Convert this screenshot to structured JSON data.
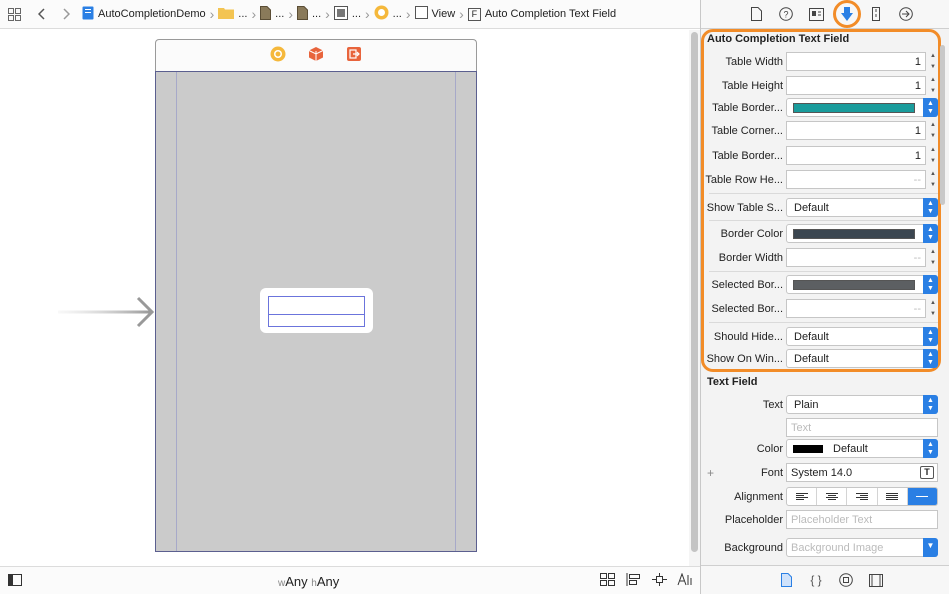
{
  "breadcrumb": {
    "items": [
      {
        "label": "AutoCompletionDemo",
        "icon": "project-icon"
      },
      {
        "label": "...",
        "icon": "folder-icon"
      },
      {
        "label": "...",
        "icon": "file-icon"
      },
      {
        "label": "...",
        "icon": "file-icon"
      },
      {
        "label": "...",
        "icon": "scene-icon"
      },
      {
        "label": "...",
        "icon": "viewcontroller-icon"
      },
      {
        "label": "View",
        "icon": "view-icon"
      },
      {
        "label": "Auto Completion Text Field",
        "icon": "custom-class-icon",
        "icon_letter": "F"
      }
    ]
  },
  "canvas": {
    "size_class": {
      "w_prefix": "w",
      "w_value": "Any",
      "h_prefix": "h",
      "h_value": "Any"
    }
  },
  "inspector": {
    "tabs": [
      "file-inspector",
      "quick-help",
      "identity-inspector",
      "attributes-inspector",
      "size-inspector",
      "connections-inspector"
    ],
    "active_tab": "attributes-inspector",
    "custom_section": {
      "title": "Auto Completion Text Field",
      "rows": [
        {
          "label": "Table Width",
          "kind": "number",
          "value": "1"
        },
        {
          "label": "Table Height",
          "kind": "number",
          "value": "1"
        },
        {
          "label": "Table Border...",
          "kind": "color",
          "color": "#1a9c9c"
        },
        {
          "label": "Table Corner...",
          "kind": "number",
          "value": "1"
        },
        {
          "label": "Table Border...",
          "kind": "number",
          "value": "1"
        },
        {
          "label": "Table Row He...",
          "kind": "number",
          "value": "--"
        },
        {
          "label": "Show Table S...",
          "kind": "popup",
          "value": "Default"
        },
        {
          "label": "Border Color",
          "kind": "color",
          "color": "#3b4650"
        },
        {
          "label": "Border Width",
          "kind": "number",
          "value": "--"
        },
        {
          "label": "Selected Bor...",
          "kind": "color",
          "color": "#5c5f62"
        },
        {
          "label": "Selected Bor...",
          "kind": "number",
          "value": "--"
        },
        {
          "label": "Should Hide...",
          "kind": "popup",
          "value": "Default"
        },
        {
          "label": "Show On Win...",
          "kind": "popup",
          "value": "Default"
        }
      ]
    },
    "text_field_section": {
      "title": "Text Field",
      "text_label": "Text",
      "text_value": "Plain",
      "text_placeholder": "Text",
      "color_label": "Color",
      "color_value": "Default",
      "font_label": "Font",
      "font_value": "System 14.0",
      "alignment_label": "Alignment",
      "placeholder_label": "Placeholder",
      "placeholder_placeholder": "Placeholder Text",
      "background_label": "Background",
      "background_placeholder": "Background Image"
    },
    "library_tabs": [
      "file-template-library",
      "code-snippet-library",
      "object-library",
      "media-library"
    ],
    "active_library_tab": "file-template-library"
  },
  "colors": {
    "accent": "#2a7fe4",
    "highlight": "#f28c28",
    "device": "#cbcbcb"
  }
}
